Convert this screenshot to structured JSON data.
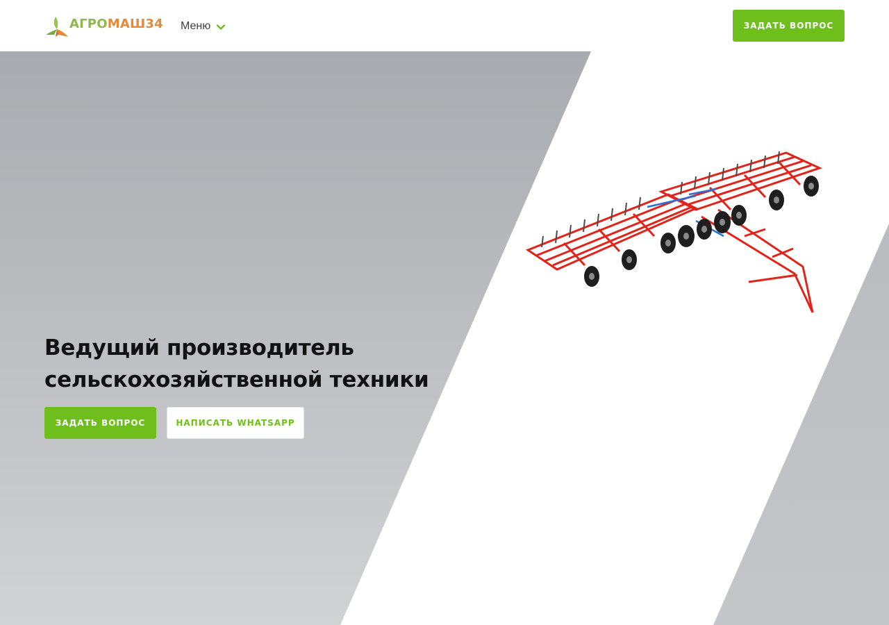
{
  "header": {
    "logo": {
      "text_part1": "АГРО",
      "text_part2": "МАШ34",
      "icon": "leaf-logo-icon"
    },
    "menu_label": "Меню",
    "menu_icon": "chevron-down-icon",
    "ask_button_label": "ЗАДАТЬ ВОПРОС"
  },
  "hero": {
    "title": "Ведущий производитель сельскохозяйственной техники",
    "primary_button_label": "ЗАДАТЬ ВОПРОС",
    "secondary_button_label": "НАПИСАТЬ WHATSAPP",
    "product_image": "cultivator-image"
  },
  "colors": {
    "accent_green": "#6ebf1c",
    "logo_green": "#8fb84a",
    "logo_orange": "#e58a3a",
    "machine_red": "#e2231a",
    "background_gray": "#aeb1b5"
  }
}
